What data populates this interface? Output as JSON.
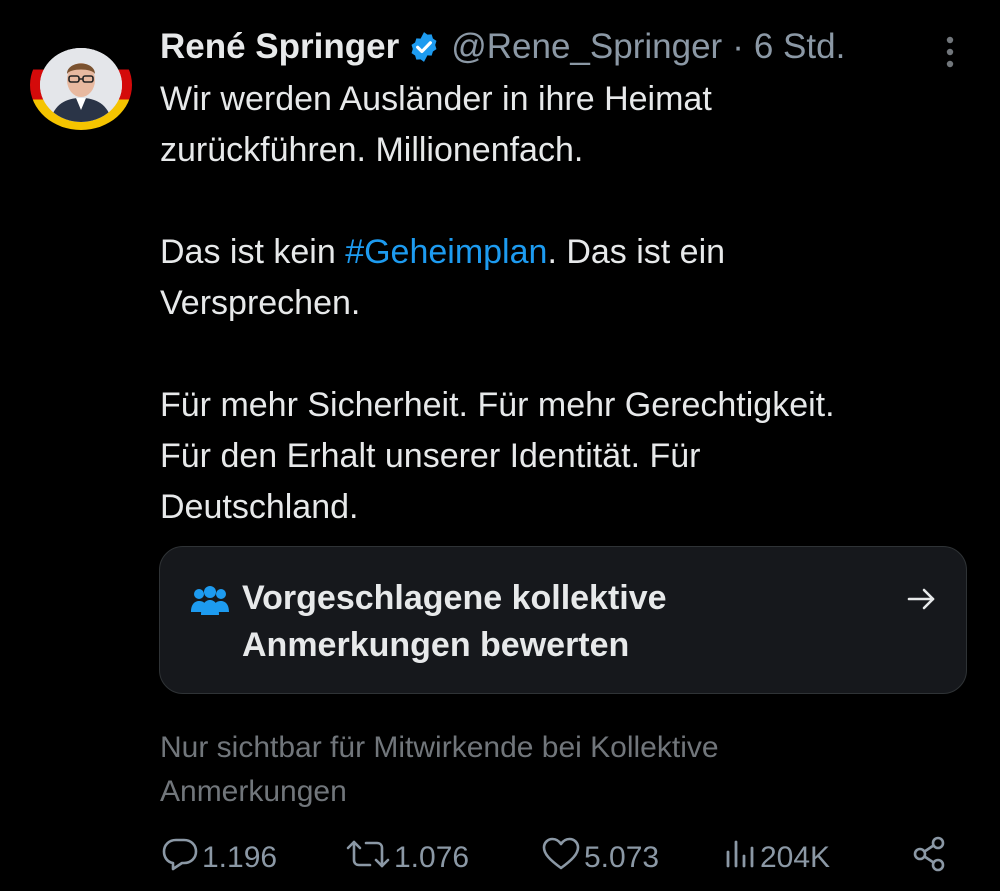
{
  "tweet": {
    "author": {
      "name": "René Springer",
      "handle": "@Rene_Springer",
      "verified": true,
      "verified_color": "#1d9bf0",
      "avatar_icon": "avatar-photo"
    },
    "separator": "·",
    "time": "6 Std.",
    "paragraphs": [
      [
        "Wir werden Ausländer in ihre Heimat",
        "zurückführen. Millionenfach."
      ],
      [
        "Das ist kein ",
        "#Geheimplan",
        ". Das ist ein",
        "Versprechen."
      ],
      [
        "Für mehr Sicherheit. Für mehr Gerechtigkeit.",
        "Für den Erhalt unserer Identität. Für",
        "Deutschland."
      ]
    ],
    "hashtag_color": "#1d9bf0",
    "community_notes": {
      "icon": "people-icon",
      "title_line1": "Vorgeschlagene kollektive",
      "title_line2": "Anmerkungen bewerten",
      "arrow_icon": "arrow-right-icon",
      "accent_color": "#1d9bf0"
    },
    "visibility_line1": "Nur sichtbar für Mitwirkende bei Kollektive",
    "visibility_line2": "Anmerkungen",
    "actions": {
      "reply_count": "1.196",
      "retweet_count": "1.076",
      "like_count": "5.073",
      "views_count": "204K"
    }
  }
}
